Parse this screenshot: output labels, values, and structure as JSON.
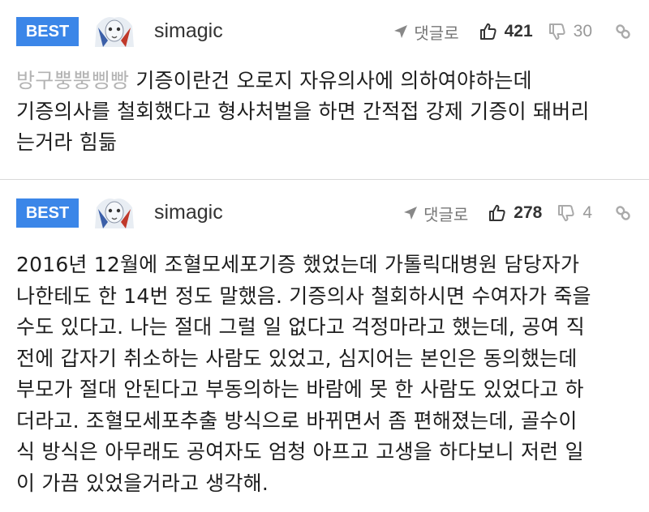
{
  "comments": [
    {
      "badge": "BEST",
      "username": "simagic",
      "reply_label": "댓글로",
      "likes": "421",
      "dislikes": "30",
      "mention": "방구뿡뿡삥빵",
      "text": " 기증이란건 오로지 자유의사에 의하여야하는데\n기증의사를 철회했다고 형사처벌을 하면 간적접 강제 기증이 돼버리\n는거라 힘듦"
    },
    {
      "badge": "BEST",
      "username": "simagic",
      "reply_label": "댓글로",
      "likes": "278",
      "dislikes": "4",
      "text": "2016년 12월에 조혈모세포기증 했었는데 가톨릭대병원 담당자가\n나한테도 한 14번 정도 말했음. 기증의사 철회하시면 수여자가 죽을\n수도 있다고. 나는 절대 그럴 일 없다고 걱정마라고 했는데, 공여 직\n전에 갑자기 취소하는 사람도 있었고, 심지어는 본인은 동의했는데\n부모가 절대 안된다고 부동의하는 바람에 못 한 사람도 있었다고 하\n더라고. 조혈모세포추출 방식으로 바뀌면서 좀 편해졌는데, 골수이\n식 방식은 아무래도 공여자도 엄청 아프고 고생을 하다보니 저런 일\n이 가끔 있었을거라고 생각해."
    }
  ],
  "icons": {
    "reply": "reply-arrow-icon",
    "like": "thumbs-up-icon",
    "dislike": "thumbs-down-icon",
    "link": "link-icon"
  },
  "colors": {
    "badge": "#3b86e8",
    "mention": "#b3b3b3"
  }
}
